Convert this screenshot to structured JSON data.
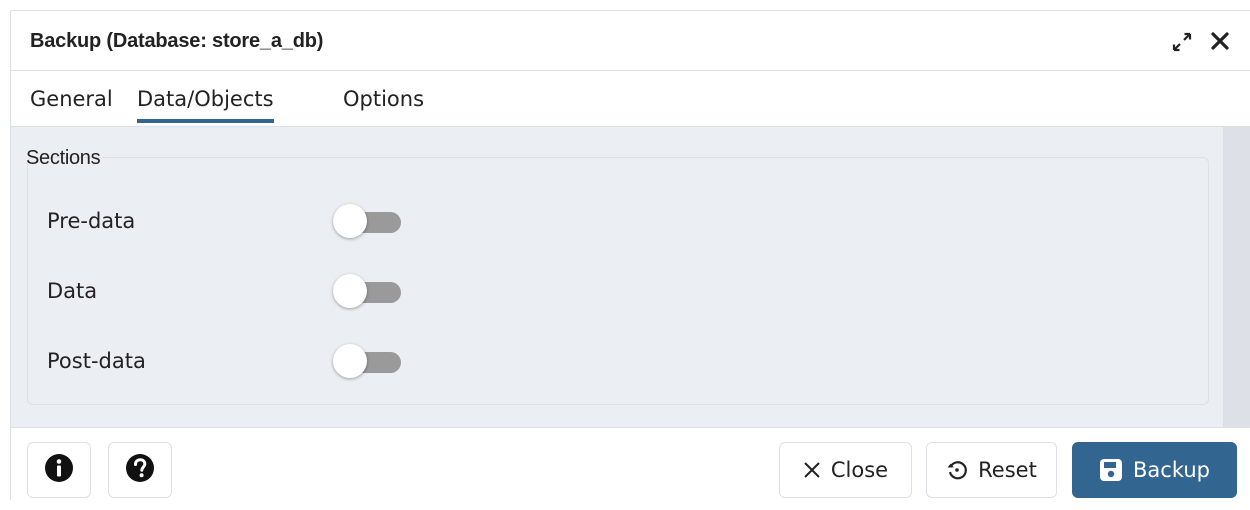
{
  "dialog": {
    "title": "Backup (Database: store_a_db)"
  },
  "tabs": [
    {
      "label": "General",
      "active": false
    },
    {
      "label": "Data/Objects",
      "active": true
    },
    {
      "label": "Options",
      "active": false
    }
  ],
  "sections": {
    "legend": "Sections",
    "rows": [
      {
        "label": "Pre-data",
        "enabled": false
      },
      {
        "label": "Data",
        "enabled": false
      },
      {
        "label": "Post-data",
        "enabled": false
      }
    ]
  },
  "footer": {
    "info_icon": "info-icon",
    "help_icon": "help-icon",
    "close_label": "Close",
    "reset_label": "Reset",
    "backup_label": "Backup"
  },
  "colors": {
    "accent": "#326690",
    "panel_bg": "#ebeef3",
    "toggle_off": "#9a9a9a"
  }
}
